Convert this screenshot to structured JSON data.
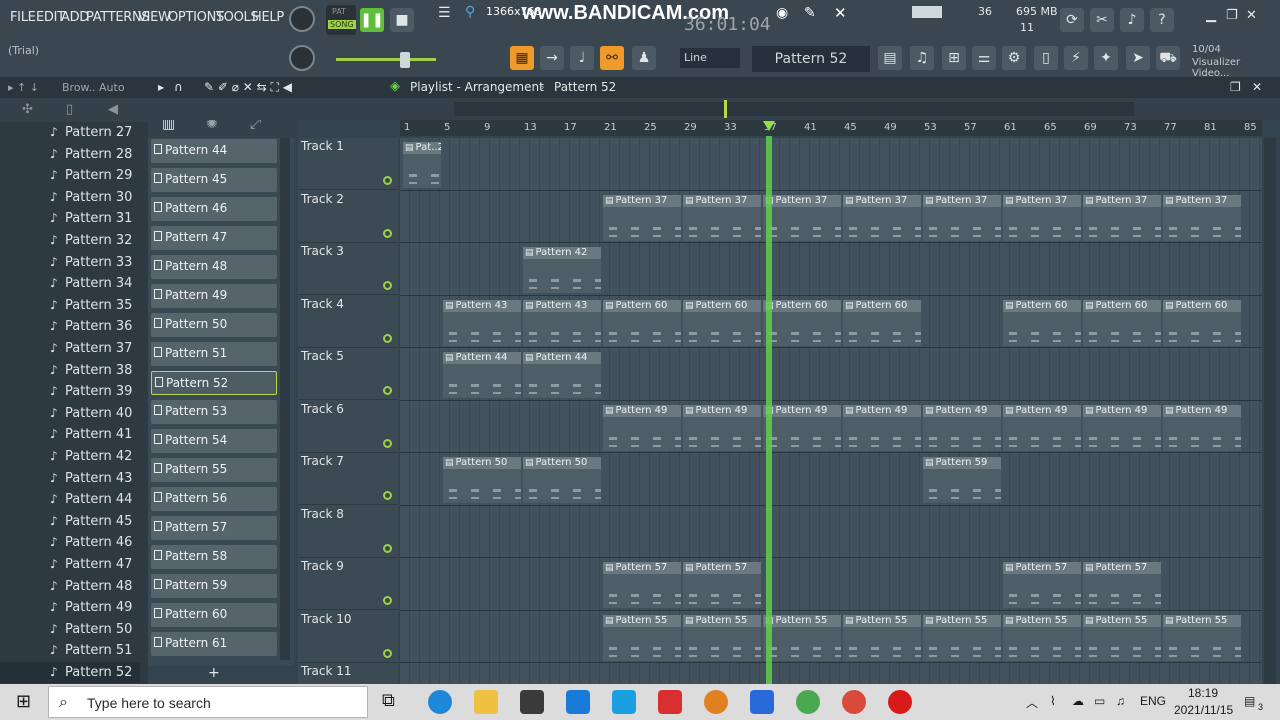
{
  "menu": [
    "FILE",
    "EDIT",
    "ADD",
    "PATTERNS",
    "VIEW",
    "OPTIONS",
    "TOOLS",
    "HELP"
  ],
  "trial_label": "(Trial)",
  "watermark": "www.BANDICAM.com",
  "resolution": "1366x768",
  "time_display": "36:01:04",
  "mode": {
    "pat": "PAT",
    "song": "SONG"
  },
  "snap": "Line",
  "current_pattern": "Pattern 52",
  "cpu": "36",
  "memory": "695 MB",
  "polyphony": "11",
  "hint": {
    "date": "10/04",
    "text": "Visualizer Video..."
  },
  "browser": {
    "title": "Brow.. Auto",
    "items": [
      "Pattern 27",
      "Pattern 28",
      "Pattern 29",
      "Pattern 30",
      "Pattern 31",
      "Pattern 32",
      "Pattern 33",
      "Pattern 34",
      "Pattern 35",
      "Pattern 36",
      "Pattern 37",
      "Pattern 38",
      "Pattern 39",
      "Pattern 40",
      "Pattern 41",
      "Pattern 42",
      "Pattern 43",
      "Pattern 44",
      "Pattern 45",
      "Pattern 46",
      "Pattern 47",
      "Pattern 48",
      "Pattern 49",
      "Pattern 50",
      "Pattern 51",
      "Pattern 52"
    ]
  },
  "picker": {
    "items": [
      "Pattern 44",
      "Pattern 45",
      "Pattern 46",
      "Pattern 47",
      "Pattern 48",
      "Pattern 49",
      "Pattern 50",
      "Pattern 51",
      "Pattern 52",
      "Pattern 53",
      "Pattern 54",
      "Pattern 55",
      "Pattern 56",
      "Pattern 57",
      "Pattern 58",
      "Pattern 59",
      "Pattern 60",
      "Pattern 61"
    ],
    "selected": "Pattern 52",
    "add": "+"
  },
  "playlist": {
    "title": "Playlist - Arrangement",
    "pattern": "Pattern 52",
    "ruler": [
      "1",
      "5",
      "9",
      "13",
      "17",
      "21",
      "25",
      "29",
      "33",
      "37",
      "41",
      "45",
      "49",
      "53",
      "57",
      "61",
      "65",
      "69",
      "73",
      "77",
      "81",
      "85"
    ],
    "tracks": [
      "Track 1",
      "Track 2",
      "Track 3",
      "Track 4",
      "Track 5",
      "Track 6",
      "Track 7",
      "Track 8",
      "Track 9",
      "Track 10",
      "Track 11"
    ],
    "clips": [
      {
        "track": 0,
        "start": 1,
        "len": 4,
        "label": "Pat..2"
      },
      {
        "track": 1,
        "start": 21,
        "len": 8,
        "label": "Pattern 37"
      },
      {
        "track": 1,
        "start": 29,
        "len": 8,
        "label": "Pattern 37"
      },
      {
        "track": 1,
        "start": 37,
        "len": 8,
        "label": "Pattern 37"
      },
      {
        "track": 1,
        "start": 45,
        "len": 8,
        "label": "Pattern 37"
      },
      {
        "track": 1,
        "start": 53,
        "len": 8,
        "label": "Pattern 37"
      },
      {
        "track": 1,
        "start": 61,
        "len": 8,
        "label": "Pattern 37"
      },
      {
        "track": 1,
        "start": 69,
        "len": 8,
        "label": "Pattern 37"
      },
      {
        "track": 1,
        "start": 77,
        "len": 8,
        "label": "Pattern 37"
      },
      {
        "track": 2,
        "start": 13,
        "len": 8,
        "label": "Pattern 42"
      },
      {
        "track": 3,
        "start": 5,
        "len": 8,
        "label": "Pattern 43"
      },
      {
        "track": 3,
        "start": 13,
        "len": 8,
        "label": "Pattern 43"
      },
      {
        "track": 3,
        "start": 21,
        "len": 8,
        "label": "Pattern 60"
      },
      {
        "track": 3,
        "start": 29,
        "len": 8,
        "label": "Pattern 60"
      },
      {
        "track": 3,
        "start": 37,
        "len": 8,
        "label": "Pattern 60"
      },
      {
        "track": 3,
        "start": 45,
        "len": 8,
        "label": "Pattern 60"
      },
      {
        "track": 3,
        "start": 61,
        "len": 8,
        "label": "Pattern 60"
      },
      {
        "track": 3,
        "start": 69,
        "len": 8,
        "label": "Pattern 60"
      },
      {
        "track": 3,
        "start": 77,
        "len": 8,
        "label": "Pattern 60"
      },
      {
        "track": 4,
        "start": 5,
        "len": 8,
        "label": "Pattern 44"
      },
      {
        "track": 4,
        "start": 13,
        "len": 8,
        "label": "Pattern 44"
      },
      {
        "track": 5,
        "start": 21,
        "len": 8,
        "label": "Pattern 49"
      },
      {
        "track": 5,
        "start": 29,
        "len": 8,
        "label": "Pattern 49"
      },
      {
        "track": 5,
        "start": 37,
        "len": 8,
        "label": "Pattern 49"
      },
      {
        "track": 5,
        "start": 45,
        "len": 8,
        "label": "Pattern 49"
      },
      {
        "track": 5,
        "start": 53,
        "len": 8,
        "label": "Pattern 49"
      },
      {
        "track": 5,
        "start": 61,
        "len": 8,
        "label": "Pattern 49"
      },
      {
        "track": 5,
        "start": 69,
        "len": 8,
        "label": "Pattern 49"
      },
      {
        "track": 5,
        "start": 77,
        "len": 8,
        "label": "Pattern 49"
      },
      {
        "track": 6,
        "start": 5,
        "len": 8,
        "label": "Pattern 50"
      },
      {
        "track": 6,
        "start": 13,
        "len": 8,
        "label": "Pattern 50"
      },
      {
        "track": 6,
        "start": 53,
        "len": 8,
        "label": "Pattern 59"
      },
      {
        "track": 8,
        "start": 21,
        "len": 8,
        "label": "Pattern 57"
      },
      {
        "track": 8,
        "start": 29,
        "len": 8,
        "label": "Pattern 57"
      },
      {
        "track": 8,
        "start": 61,
        "len": 8,
        "label": "Pattern 57"
      },
      {
        "track": 8,
        "start": 69,
        "len": 8,
        "label": "Pattern 57"
      },
      {
        "track": 9,
        "start": 21,
        "len": 8,
        "label": "Pattern 55"
      },
      {
        "track": 9,
        "start": 29,
        "len": 8,
        "label": "Pattern 55"
      },
      {
        "track": 9,
        "start": 37,
        "len": 8,
        "label": "Pattern 55"
      },
      {
        "track": 9,
        "start": 45,
        "len": 8,
        "label": "Pattern 55"
      },
      {
        "track": 9,
        "start": 53,
        "len": 8,
        "label": "Pattern 55"
      },
      {
        "track": 9,
        "start": 61,
        "len": 8,
        "label": "Pattern 55"
      },
      {
        "track": 9,
        "start": 69,
        "len": 8,
        "label": "Pattern 55"
      },
      {
        "track": 9,
        "start": 77,
        "len": 8,
        "label": "Pattern 55"
      }
    ],
    "playhead_bar": 37
  },
  "taskbar": {
    "search_placeholder": "Type here to search",
    "lang": "ENG",
    "time": "18:19",
    "date": "2021/11/15",
    "notifications": "3"
  }
}
